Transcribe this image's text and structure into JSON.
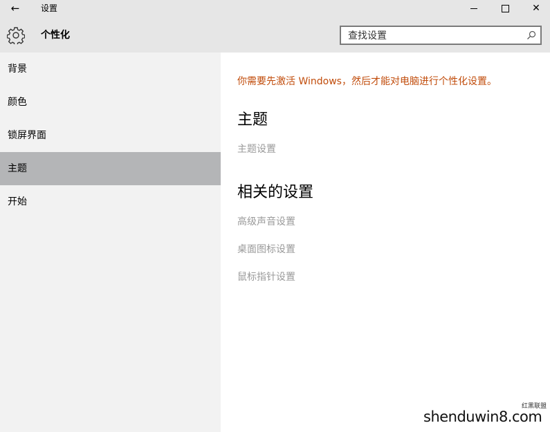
{
  "window": {
    "title": "设置",
    "back_glyph": "←",
    "close_glyph": "✕"
  },
  "header": {
    "page_title": "个性化",
    "icon": "gear-icon",
    "search": {
      "placeholder": "查找设置",
      "icon": "search-icon"
    }
  },
  "sidebar": {
    "items": [
      {
        "label": "背景",
        "selected": false
      },
      {
        "label": "颜色",
        "selected": false
      },
      {
        "label": "锁屏界面",
        "selected": false
      },
      {
        "label": "主题",
        "selected": true
      },
      {
        "label": "开始",
        "selected": false
      }
    ]
  },
  "content": {
    "activation_warning": "你需要先激活 Windows，然后才能对电脑进行个性化设置。",
    "theme_heading": "主题",
    "theme_settings_link": "主题设置",
    "related_heading": "相关的设置",
    "related_links": [
      "高级声音设置",
      "桌面图标设置",
      "鼠标指针设置"
    ]
  },
  "watermark": {
    "text": "shenduwin8.com",
    "small_text": "红黑联盟"
  },
  "colors": {
    "titlebar_bg": "#e6e6e6",
    "sidebar_bg": "#f2f2f2",
    "selected_bg": "#b4b5b7",
    "warning": "#c14c0b",
    "disabled_link": "#9a9a9a"
  }
}
